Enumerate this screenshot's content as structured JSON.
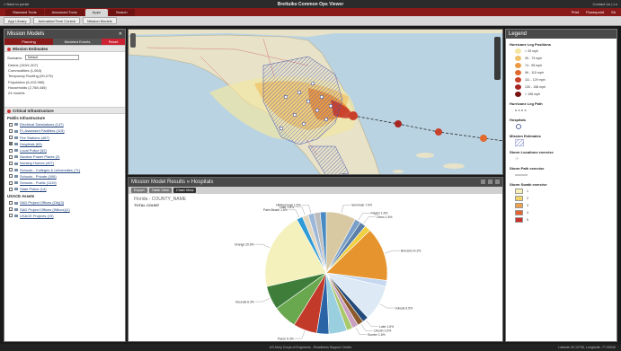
{
  "app": {
    "back_link": "« Back to portal",
    "title": "Brettuiko Common Ops Viewer",
    "top_right": "Contact Us | Lo"
  },
  "tabs": [
    {
      "label": "Standard Tools",
      "active": false
    },
    {
      "label": "Advanced Tools",
      "active": false
    },
    {
      "label": "Apps",
      "active": true
    },
    {
      "label": "Search",
      "active": false
    }
  ],
  "tab_actions": [
    "Print",
    "Powerpoint",
    "Sh"
  ],
  "toolbar": [
    "App Library",
    "Animation/Time Control",
    "Mission Models"
  ],
  "left": {
    "title": "Mission Models",
    "subtabs": [
      "Planning",
      "Modeled Events",
      "Reset"
    ],
    "mission_estimates": {
      "header": "Mission Estimates",
      "scenario_label": "Scenario:",
      "scenario_value": "Default",
      "lines": [
        "Debris (153/1,307)",
        "Commodities (1,063)",
        "Temporary Roofing (90,075)",
        "Population (6,410,969)",
        "Households (2,768,446)",
        "24 models"
      ]
    },
    "critical": {
      "header": "Critical Infrastructure",
      "public_label": "Public Infrastructure",
      "public_items": [
        {
          "label": "Electrical Substations (147)",
          "checked": false
        },
        {
          "label": "FL Assessed Facilities (115)",
          "checked": false
        },
        {
          "label": "Fire Stations (487)",
          "checked": false
        },
        {
          "label": "Hospitals (63)",
          "checked": true
        },
        {
          "label": "Local Police (52)",
          "checked": false
        },
        {
          "label": "Nuclear Power Plants (2)",
          "checked": false
        },
        {
          "label": "Nursing Homes (407)",
          "checked": false
        },
        {
          "label": "Schools - Colleges & Universities (71)",
          "checked": false
        },
        {
          "label": "Schools - Private (406)",
          "checked": false
        },
        {
          "label": "Schools - Public (1119)",
          "checked": false
        },
        {
          "label": "State Police (14)",
          "checked": false
        }
      ],
      "usace_label": "USACE Assets",
      "usace_items": [
        {
          "label": "SAD Project Offices (Ok)(3)",
          "checked": false
        },
        {
          "label": "SAD Project Offices (Wilcox)(1)",
          "checked": false
        },
        {
          "label": "USACE Projects (19)",
          "checked": false
        }
      ]
    }
  },
  "results": {
    "title": "Mission Model Results » Hospitals",
    "buttons": [
      "Export",
      "Table View",
      "Chart View"
    ],
    "heading": "Florida - COUNTY_NAME",
    "total": "TOTAL COUNT"
  },
  "chart_data": {
    "type": "pie",
    "slices": [
      {
        "label": "Seminole 7.9%",
        "value": 7.9,
        "color": "#d8c9a3"
      },
      {
        "label": "Flagler 1.6%",
        "value": 1.6,
        "color": "#7aa0c9"
      },
      {
        "label": "Citrus 1.6%",
        "value": 1.6,
        "color": "#5b7fa8"
      },
      {
        "label": "",
        "value": 1.6,
        "color": "#f0d040"
      },
      {
        "label": "Brevard 14.3%",
        "value": 14.3,
        "color": "#e6952e"
      },
      {
        "label": "",
        "value": 1.6,
        "color": "#c5d8ef"
      },
      {
        "label": "Volusia 9.5%",
        "value": 9.5,
        "color": "#ddeaf5"
      },
      {
        "label": "Lake 1.6%",
        "value": 1.6,
        "color": "#224a7a"
      },
      {
        "label": "Lincoln 1.6%",
        "value": 1.6,
        "color": "#8b5a2b"
      },
      {
        "label": "Sumter 1.6%",
        "value": 1.6,
        "color": "#c9a0c0"
      },
      {
        "label": "",
        "value": 1.6,
        "color": "#a8c86a"
      },
      {
        "label": "",
        "value": 4.8,
        "color": "#9acfe0"
      },
      {
        "label": "",
        "value": 3.2,
        "color": "#2b64a6"
      },
      {
        "label": "Pasco 6.3%",
        "value": 6.3,
        "color": "#c23a2a"
      },
      {
        "label": "",
        "value": 6.3,
        "color": "#6aa84f"
      },
      {
        "label": "Osceola 6.3%",
        "value": 6.3,
        "color": "#3e7d3a"
      },
      {
        "label": "Orange 20.6%",
        "value": 20.6,
        "color": "#f4f1bd"
      },
      {
        "label": "Palm Beach 1.6%",
        "value": 1.6,
        "color": "#2f9bd6"
      },
      {
        "label": "Lake 1.6%",
        "value": 1.6,
        "color": "#e4d7bf"
      },
      {
        "label": "Hillsborough 1.6%",
        "value": 1.6,
        "color": "#9cb7d8"
      },
      {
        "label": "",
        "value": 1.6,
        "color": "#bdbdbd"
      },
      {
        "label": "",
        "value": 1.6,
        "color": "#4a8ac2"
      }
    ]
  },
  "legend": {
    "title": "Legend",
    "hurricane_header": "Hurricane Leg Positions",
    "hurricane_rows": [
      {
        "label": "< 39 mph",
        "color": "#f5e6a0"
      },
      {
        "label": "39 - 73 mph",
        "color": "#f2c16a"
      },
      {
        "label": "74 - 95 mph",
        "color": "#ec9a45"
      },
      {
        "label": "96 - 110 mph",
        "color": "#e06a30"
      },
      {
        "label": "111 - 129 mph",
        "color": "#c9402a"
      },
      {
        "label": "130 - 156 mph",
        "color": "#a82622"
      },
      {
        "label": "> 156 mph",
        "color": "#7a1212"
      }
    ],
    "path_header": "Hurricane Leg Path",
    "hospitals_header": "Hospitals",
    "estimates_header": "Mission Estimates",
    "storm_loc_header": "Storm Locations exercise",
    "storm_path_header": "Storm Path exercise",
    "storm_swath_header": "Storm Swath exercise",
    "swath_rows": [
      {
        "label": "1",
        "color": "#f7f1b8"
      },
      {
        "label": "2",
        "color": "#f2d36a"
      },
      {
        "label": "3",
        "color": "#eea04a"
      },
      {
        "label": "4",
        "color": "#e4622e"
      },
      {
        "label": "5",
        "color": "#c9302a"
      }
    ]
  },
  "footer": {
    "center": "US Army Corps of Engineers - Readiness Support Center",
    "right": "Latitude 30.10706, Longitude -77.00040"
  }
}
